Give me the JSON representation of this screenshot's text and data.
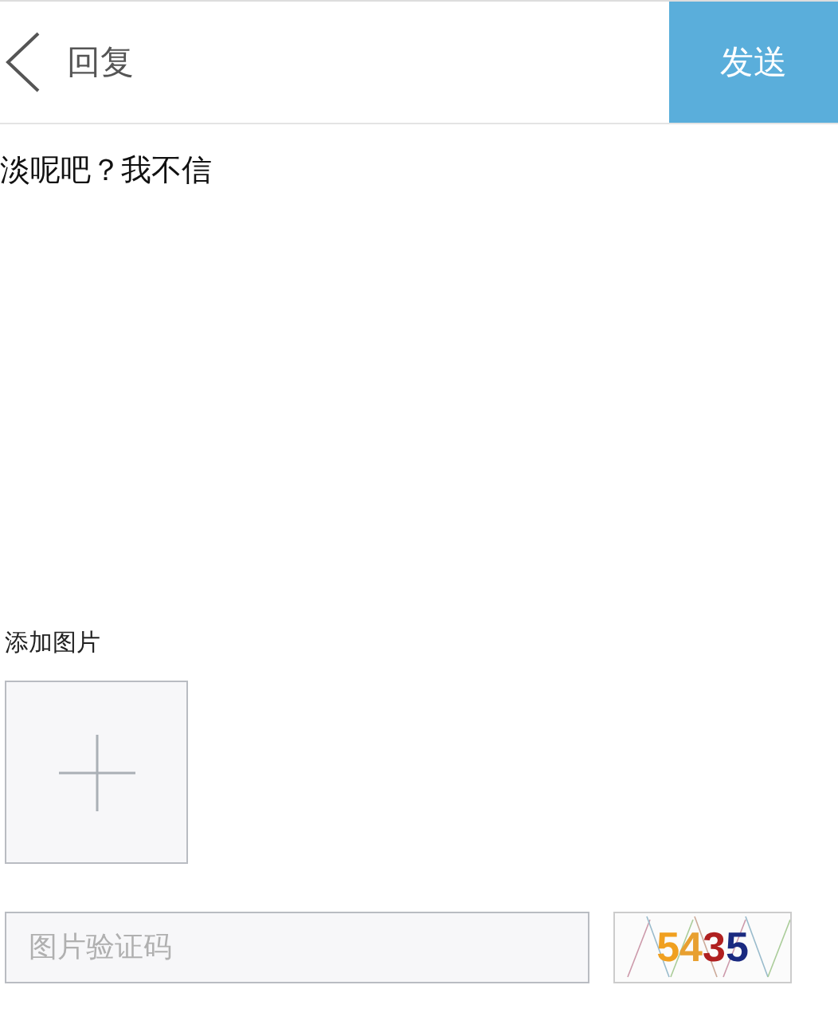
{
  "header": {
    "title": "回复",
    "send_button": "发送"
  },
  "message": {
    "value": "淡呢吧？我不信"
  },
  "attachments": {
    "label": "添加图片"
  },
  "captcha_field": {
    "placeholder": "图片验证码"
  },
  "captcha_image": {
    "characters": [
      {
        "text": "5",
        "color": "#f0a020"
      },
      {
        "text": "4",
        "color": "#e8a030"
      },
      {
        "text": "3",
        "color": "#b02020"
      },
      {
        "text": "5",
        "color": "#1a2a80"
      }
    ]
  }
}
